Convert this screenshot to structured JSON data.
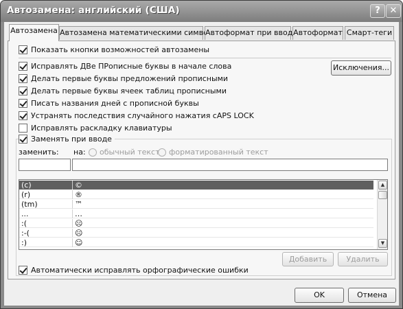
{
  "window": {
    "title": "Автозамена: английский (США)",
    "help_glyph": "?",
    "close_glyph": "✕"
  },
  "tabs": [
    {
      "label": "Автозамена",
      "active": true
    },
    {
      "label": "Автозамена математическими символами",
      "active": false
    },
    {
      "label": "Автоформат при вводе",
      "active": false
    },
    {
      "label": "Автоформат",
      "active": false
    },
    {
      "label": "Смарт-теги",
      "active": false
    }
  ],
  "options": {
    "show_buttons": {
      "label": "Показать кнопки возможностей автозамены",
      "checked": true
    },
    "two_caps": {
      "label": "Исправлять ДВе ПРописные буквы в начале слова",
      "checked": true
    },
    "sentence_caps": {
      "label": "Делать первые буквы предложений прописными",
      "checked": true
    },
    "table_caps": {
      "label": "Делать первые буквы ячеек таблиц прописными",
      "checked": true
    },
    "day_names": {
      "label": "Писать названия дней с прописной буквы",
      "checked": true
    },
    "caps_lock": {
      "label": "Устранять последствия случайного нажатия cAPS LOCK",
      "checked": true
    },
    "keyboard_layout": {
      "label": "Исправлять раскладку клавиатуры",
      "checked": false
    },
    "replace_typing": {
      "label": "Заменять при вводе",
      "checked": true
    },
    "auto_spelling": {
      "label": "Автоматически исправлять орфографические ошибки",
      "checked": true
    }
  },
  "buttons": {
    "exceptions": "Исключения...",
    "add": "Добавить",
    "delete": "Удалить",
    "ok": "OK",
    "cancel": "Отмена"
  },
  "replace": {
    "replace_label": "заменить:",
    "with_label": "на:",
    "plain_text": "обычный текст",
    "formatted_text": "форматированный текст",
    "replace_value": "",
    "with_value": ""
  },
  "replacement_list": [
    {
      "from": "(c)",
      "to": "©",
      "selected": true
    },
    {
      "from": "(r)",
      "to": "®",
      "selected": false
    },
    {
      "from": "(tm)",
      "to": "™",
      "selected": false
    },
    {
      "from": "...",
      "to": "…",
      "selected": false
    },
    {
      "from": ":(",
      "to": "☹",
      "selected": false
    },
    {
      "from": ":-(",
      "to": "☹",
      "selected": false
    },
    {
      "from": ":)",
      "to": "☺",
      "selected": false
    }
  ],
  "scrollbar": {
    "up_glyph": "▲",
    "down_glyph": "▼"
  }
}
